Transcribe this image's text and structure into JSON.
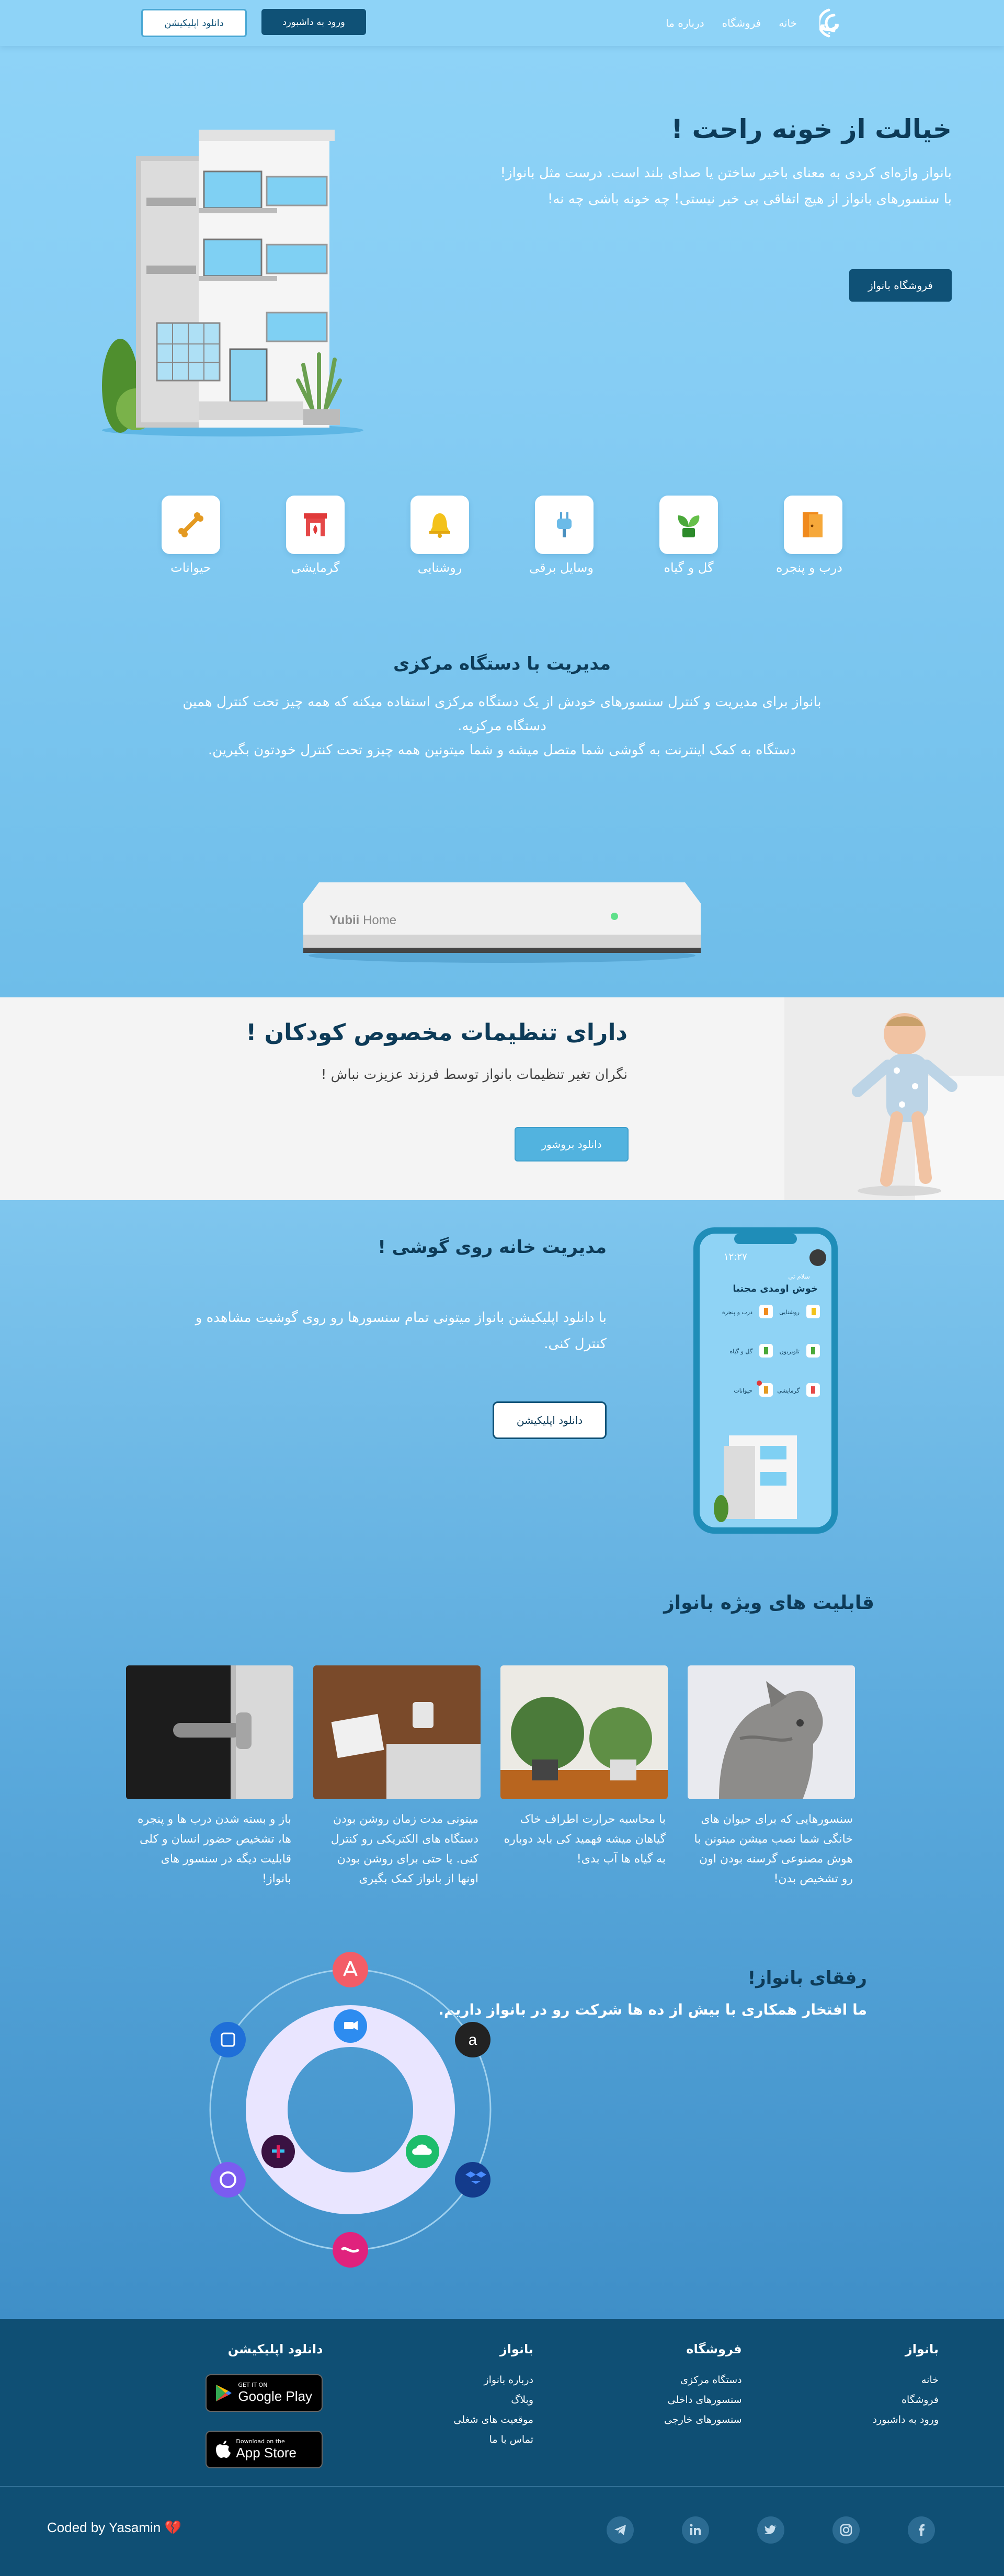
{
  "nav": {
    "logo_text": "ب",
    "links": [
      "خانه",
      "فروشگاه",
      "درباره ما"
    ],
    "login_label": "ورود به داشبورد",
    "download_label": "دانلود اپلیکیشن"
  },
  "hero": {
    "title": "خیالت از خونه راحت !",
    "desc_line1": "بانواز واژه‌ای کردی به معنای باخیر ساختن یا صدای بلند است. درست مثل بانواز!",
    "desc_line2": "با سنسورهای بانواز از هیچ اتفاقی بی خبر نیستی! چه خونه باشی چه نه!",
    "shop_label": "فروشگاه بانواز"
  },
  "categories": [
    {
      "label": "درب و پنجره",
      "icon": "door-icon"
    },
    {
      "label": "گل و گیاه",
      "icon": "plant-icon"
    },
    {
      "label": "وسایل برقی",
      "icon": "plug-icon"
    },
    {
      "label": "روشنایی",
      "icon": "bell-lamp-icon"
    },
    {
      "label": "گرمایشی",
      "icon": "fireplace-icon"
    },
    {
      "label": "حیوانات",
      "icon": "bone-icon"
    }
  ],
  "central": {
    "title": "مدیریت با دستگاه مرکزی",
    "desc_line1": "بانواز برای مدیریت و کنترل سنسورهای خودش از یک دستگاه مرکزی استفاده میکنه که همه چیز تحت کنترل همین",
    "desc_line2": "دستگاه مرکزیه.",
    "desc_line3": "دستگاه به کمک اینترنت به گوشی شما متصل میشه و شما میتونین همه چیزو تحت کنترل خودتون بگیرین.",
    "device_brand": "Yubii",
    "device_model": "Home"
  },
  "kids": {
    "title": "دارای تنظیمات مخصوص کودکان !",
    "desc": "نگران تغیر تنظیمات بانواز توسط فرزند عزیزت نباش !",
    "brochure_label": "دانلود بروشور"
  },
  "mobile": {
    "title": "مدیریت خانه روی گوشی !",
    "desc_line1": "با دانلود اپلیکیشن بانواز میتونی تمام سنسورها رو روی گوشیت مشاهده و",
    "desc_line2": "کنترل کنی.",
    "app_label": "دانلود اپلیکیشن",
    "phone_time": "۱۲:۲۷",
    "phone_greeting_small": "سلام تی",
    "phone_greeting": "خوش اومدی مجتبا",
    "phone_items": [
      "درب و پنجره",
      "روشنایی",
      "گل و گیاه",
      "تلویزیون",
      "حیوانات",
      "گرمایشی"
    ]
  },
  "features": {
    "title": "قابلیت های ویژه بانواز",
    "cards": [
      {
        "text": "سنسورهایی که برای حیوان های خانگی شما نصب میشن میتونن با هوش مصنوعی گرسنه بودن اون رو تشخیص بدن!"
      },
      {
        "text": "با محاسبه حرارت اطراف خاک گیاهان میشه فهمید کی باید دوباره به گیاه ها آب بدی!"
      },
      {
        "text": "میتونی مدت زمان روشن بودن دستگاه های الکتریکی رو کنترل کنی. یا حتی برای روشن بودن اونها از بانواز کمک بگیری"
      },
      {
        "text": "باز و بسته شدن درب ها و پنجره ها، تشخیص حضور انسان و کلی قابلیت دیگه در سنسور های بانواز!"
      }
    ]
  },
  "partners": {
    "title": "رفقای بانواز!",
    "desc": "ما افتخار همکاری با بیش از ده ها شرکت رو در بانواز داریم."
  },
  "footer": {
    "col1": {
      "title": "بانواز",
      "items": [
        "خانه",
        "فروشگاه",
        "ورود به داشبورد"
      ]
    },
    "col2": {
      "title": "فروشگاه",
      "items": [
        "دستگاه مرکزی",
        "سنسورهای داخلی",
        "سنسورهای خارجی"
      ]
    },
    "col3": {
      "title": "بانواز",
      "items": [
        "درباره بانواز",
        "وبلاگ",
        "موقعیت های شغلی",
        "تماس با ما"
      ]
    },
    "col4": {
      "title": "دانلود اپلیکیشن"
    },
    "google_small": "GET IT ON",
    "google_big": "Google Play",
    "apple_small": "Download on the",
    "apple_big": "App Store",
    "coded_by": "Coded by Yasamin 💔"
  },
  "colors": {
    "primary": "#0f5176",
    "accent": "#52b3df",
    "sky": "#8ed3f7",
    "footer": "#0f4f74"
  }
}
